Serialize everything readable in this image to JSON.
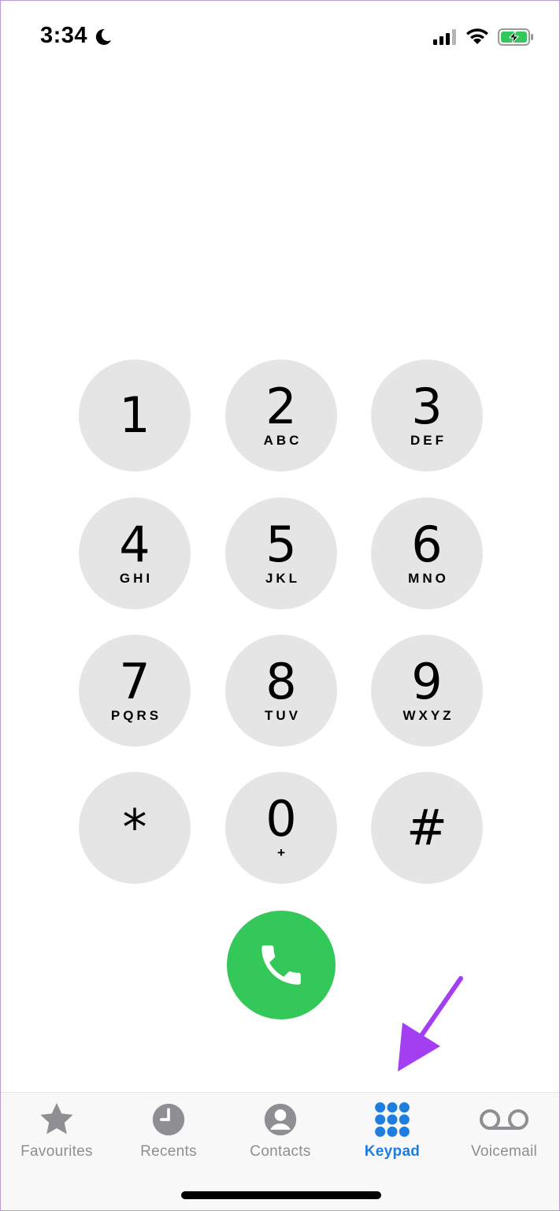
{
  "status_bar": {
    "time": "3:34",
    "icons": [
      "moon-icon",
      "cellular-signal-icon",
      "wifi-icon",
      "battery-charging-icon"
    ],
    "battery_color": "#34c759"
  },
  "keypad": {
    "keys": [
      {
        "digit": "1",
        "letters": ""
      },
      {
        "digit": "2",
        "letters": "ABC"
      },
      {
        "digit": "3",
        "letters": "DEF"
      },
      {
        "digit": "4",
        "letters": "GHI"
      },
      {
        "digit": "5",
        "letters": "JKL"
      },
      {
        "digit": "6",
        "letters": "MNO"
      },
      {
        "digit": "7",
        "letters": "PQRS"
      },
      {
        "digit": "8",
        "letters": "TUV"
      },
      {
        "digit": "9",
        "letters": "WXYZ"
      },
      {
        "digit": "*",
        "letters": ""
      },
      {
        "digit": "0",
        "letters": "+"
      },
      {
        "digit": "#",
        "letters": ""
      }
    ],
    "key_color": "#e5e5e5",
    "call_button_color": "#34c759",
    "call_icon": "phone-icon"
  },
  "annotation": {
    "arrow_color": "#a33ff0",
    "points_to": "Keypad"
  },
  "tab_bar": {
    "active_color": "#1d7ee0",
    "inactive_color": "#8e8e93",
    "tabs": [
      {
        "label": "Favourites",
        "icon": "star-icon",
        "active": false
      },
      {
        "label": "Recents",
        "icon": "clock-icon",
        "active": false
      },
      {
        "label": "Contacts",
        "icon": "person-circle-icon",
        "active": false
      },
      {
        "label": "Keypad",
        "icon": "keypad-icon",
        "active": true
      },
      {
        "label": "Voicemail",
        "icon": "voicemail-icon",
        "active": false
      }
    ]
  }
}
